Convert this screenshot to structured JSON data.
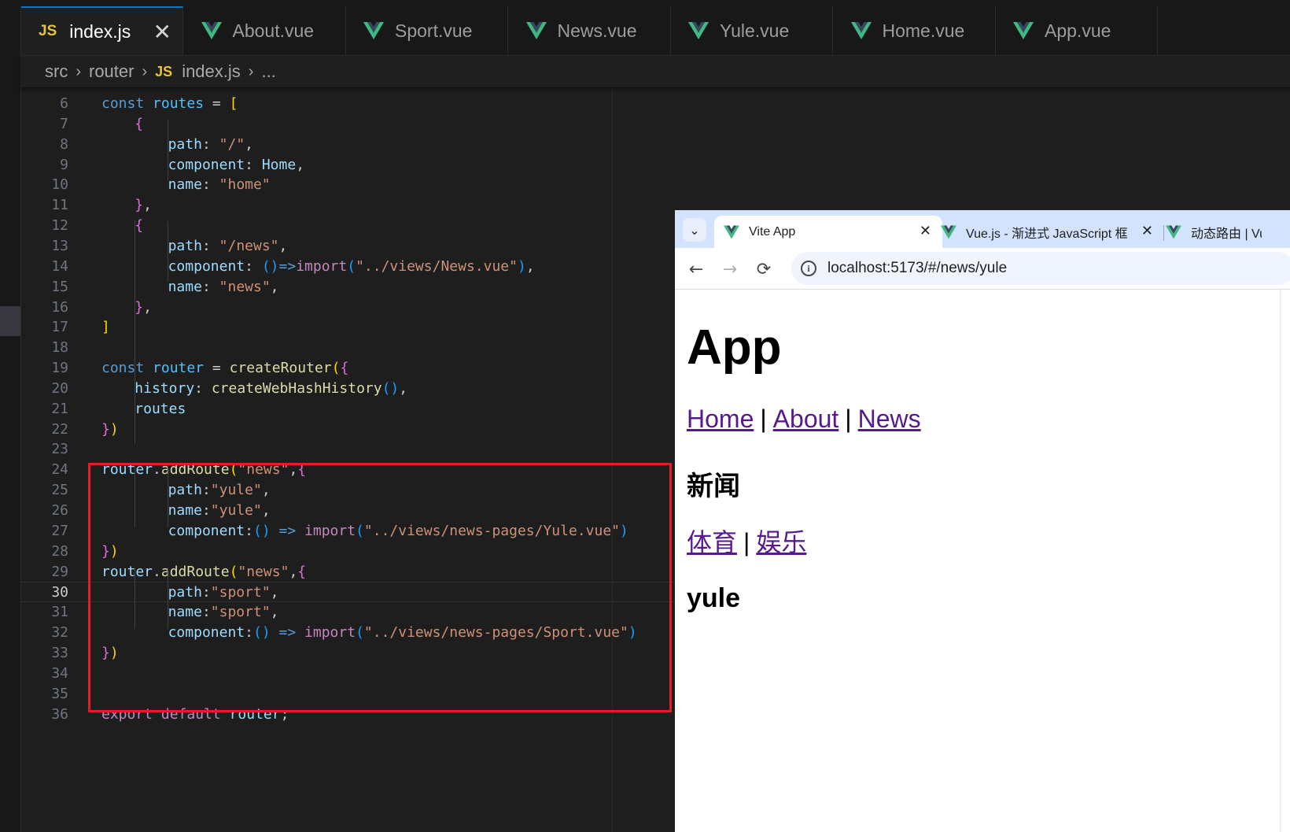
{
  "editor": {
    "tabs": [
      {
        "label": "index.js",
        "kind": "js",
        "active": true
      },
      {
        "label": "About.vue",
        "kind": "vue"
      },
      {
        "label": "Sport.vue",
        "kind": "vue"
      },
      {
        "label": "News.vue",
        "kind": "vue"
      },
      {
        "label": "Yule.vue",
        "kind": "vue"
      },
      {
        "label": "Home.vue",
        "kind": "vue"
      },
      {
        "label": "App.vue",
        "kind": "vue"
      }
    ],
    "js_badge": "JS",
    "close_glyph": "✕",
    "breadcrumb": {
      "src": "src",
      "router": "router",
      "file": "index.js",
      "more": "..."
    },
    "current_line": "30",
    "colors": {
      "vue_green": "#41b883",
      "vue_dark": "#34495e",
      "highlight_box": "#e51c23",
      "accent": "#0078d4"
    },
    "lines": [
      {
        "n": "6",
        "indent": 0,
        "tokens": [
          [
            "const ",
            "k"
          ],
          [
            "routes",
            "c"
          ],
          [
            " = ",
            ""
          ],
          [
            "[",
            "y"
          ]
        ]
      },
      {
        "n": "7",
        "indent": 1,
        "tokens": [
          [
            "{",
            "m"
          ]
        ]
      },
      {
        "n": "8",
        "indent": 2,
        "tokens": [
          [
            "path",
            "v"
          ],
          [
            ": ",
            ""
          ],
          [
            "\"/\"",
            "s"
          ],
          [
            ",",
            ""
          ]
        ]
      },
      {
        "n": "9",
        "indent": 2,
        "tokens": [
          [
            "component",
            "v"
          ],
          [
            ": ",
            ""
          ],
          [
            "Home",
            "v"
          ],
          [
            ",",
            ""
          ]
        ]
      },
      {
        "n": "10",
        "indent": 2,
        "tokens": [
          [
            "name",
            "v"
          ],
          [
            ": ",
            ""
          ],
          [
            "\"home\"",
            "s"
          ]
        ]
      },
      {
        "n": "11",
        "indent": 1,
        "tokens": [
          [
            "}",
            "m"
          ],
          [
            ",",
            ""
          ]
        ]
      },
      {
        "n": "12",
        "indent": 1,
        "tokens": [
          [
            "{",
            "m"
          ]
        ]
      },
      {
        "n": "13",
        "indent": 2,
        "tokens": [
          [
            "path",
            "v"
          ],
          [
            ": ",
            ""
          ],
          [
            "\"/news\"",
            "s"
          ],
          [
            ",",
            ""
          ]
        ]
      },
      {
        "n": "14",
        "indent": 2,
        "tokens": [
          [
            "component",
            "v"
          ],
          [
            ": ",
            ""
          ],
          [
            "()",
            "b"
          ],
          [
            "=>",
            "k"
          ],
          [
            "import",
            "kp"
          ],
          [
            "(",
            "b"
          ],
          [
            "\"../views/News.vue\"",
            "s"
          ],
          [
            ")",
            "b"
          ],
          [
            ",",
            ""
          ]
        ]
      },
      {
        "n": "15",
        "indent": 2,
        "tokens": [
          [
            "name",
            "v"
          ],
          [
            ": ",
            ""
          ],
          [
            "\"news\"",
            "s"
          ],
          [
            ",",
            ""
          ]
        ]
      },
      {
        "n": "16",
        "indent": 1,
        "tokens": [
          [
            "}",
            "m"
          ],
          [
            ",",
            ""
          ]
        ]
      },
      {
        "n": "17",
        "indent": 0,
        "tokens": [
          [
            "]",
            "y"
          ]
        ]
      },
      {
        "n": "18",
        "indent": 0,
        "tokens": []
      },
      {
        "n": "19",
        "indent": 0,
        "tokens": [
          [
            "const ",
            "k"
          ],
          [
            "router",
            "c"
          ],
          [
            " = ",
            ""
          ],
          [
            "createRouter",
            "f"
          ],
          [
            "(",
            "y"
          ],
          [
            "{",
            "m"
          ]
        ]
      },
      {
        "n": "20",
        "indent": 1,
        "tokens": [
          [
            "history",
            "v"
          ],
          [
            ": ",
            ""
          ],
          [
            "createWebHashHistory",
            "f"
          ],
          [
            "()",
            "b"
          ],
          [
            ",",
            ""
          ]
        ]
      },
      {
        "n": "21",
        "indent": 1,
        "tokens": [
          [
            "routes",
            "v"
          ]
        ]
      },
      {
        "n": "22",
        "indent": 0,
        "tokens": [
          [
            "}",
            "m"
          ],
          [
            ")",
            "y"
          ]
        ]
      },
      {
        "n": "23",
        "indent": 0,
        "tokens": []
      },
      {
        "n": "24",
        "indent": 0,
        "tokens": [
          [
            "router",
            "v"
          ],
          [
            ".",
            ""
          ],
          [
            "addRoute",
            "f"
          ],
          [
            "(",
            "y"
          ],
          [
            "\"news\"",
            "s"
          ],
          [
            ",",
            ""
          ],
          [
            "{",
            "m"
          ]
        ]
      },
      {
        "n": "25",
        "indent": 2,
        "tokens": [
          [
            "path",
            "v"
          ],
          [
            ":",
            ""
          ],
          [
            "\"yule\"",
            "s"
          ],
          [
            ",",
            ""
          ]
        ]
      },
      {
        "n": "26",
        "indent": 2,
        "tokens": [
          [
            "name",
            "v"
          ],
          [
            ":",
            ""
          ],
          [
            "\"yule\"",
            "s"
          ],
          [
            ",",
            ""
          ]
        ]
      },
      {
        "n": "27",
        "indent": 2,
        "tokens": [
          [
            "component",
            "v"
          ],
          [
            ":",
            ""
          ],
          [
            "() ",
            "b"
          ],
          [
            "=> ",
            "k"
          ],
          [
            "import",
            "kp"
          ],
          [
            "(",
            "b"
          ],
          [
            "\"../views/news-pages/Yule.vue\"",
            "s"
          ],
          [
            ")",
            "b"
          ]
        ]
      },
      {
        "n": "28",
        "indent": 0,
        "tokens": [
          [
            "}",
            "m"
          ],
          [
            ")",
            "y"
          ]
        ]
      },
      {
        "n": "29",
        "indent": 0,
        "tokens": [
          [
            "router",
            "v"
          ],
          [
            ".",
            ""
          ],
          [
            "addRoute",
            "f"
          ],
          [
            "(",
            "y"
          ],
          [
            "\"news\"",
            "s"
          ],
          [
            ",",
            ""
          ],
          [
            "{",
            "m"
          ]
        ]
      },
      {
        "n": "30",
        "indent": 2,
        "tokens": [
          [
            "path",
            "v"
          ],
          [
            ":",
            ""
          ],
          [
            "\"sport\"",
            "s"
          ],
          [
            ",",
            ""
          ]
        ]
      },
      {
        "n": "31",
        "indent": 2,
        "tokens": [
          [
            "name",
            "v"
          ],
          [
            ":",
            ""
          ],
          [
            "\"sport\"",
            "s"
          ],
          [
            ",",
            ""
          ]
        ]
      },
      {
        "n": "32",
        "indent": 2,
        "tokens": [
          [
            "component",
            "v"
          ],
          [
            ":",
            ""
          ],
          [
            "() ",
            "b"
          ],
          [
            "=> ",
            "k"
          ],
          [
            "import",
            "kp"
          ],
          [
            "(",
            "b"
          ],
          [
            "\"../views/news-pages/Sport.vue\"",
            "s"
          ],
          [
            ")",
            "b"
          ]
        ]
      },
      {
        "n": "33",
        "indent": 0,
        "tokens": [
          [
            "}",
            "m"
          ],
          [
            ")",
            "y"
          ]
        ]
      },
      {
        "n": "34",
        "indent": 0,
        "tokens": []
      },
      {
        "n": "35",
        "indent": 0,
        "tokens": []
      },
      {
        "n": "36",
        "indent": 0,
        "tokens": [
          [
            "export ",
            "kp"
          ],
          [
            "default ",
            "kp"
          ],
          [
            "router",
            "v"
          ],
          [
            ";",
            ""
          ]
        ]
      }
    ]
  },
  "browser": {
    "tabs": [
      {
        "label": "Vite App",
        "active": true
      },
      {
        "label": "Vue.js - 渐进式 JavaScript 框架",
        "active": false
      },
      {
        "label": "动态路由 | Vue",
        "active": false
      }
    ],
    "tab_close": "✕",
    "url": "localhost:5173/#/news/yule",
    "info_glyph": "i",
    "back_glyph": "←",
    "forward_glyph": "→",
    "reload_glyph": "⟳",
    "menu_glyph": "⌄",
    "page": {
      "title": "App",
      "nav": [
        "Home",
        "About",
        "News"
      ],
      "separator": "|",
      "section_title": "新闻",
      "subnav": [
        "体育",
        "娱乐"
      ],
      "content": "yule"
    }
  }
}
